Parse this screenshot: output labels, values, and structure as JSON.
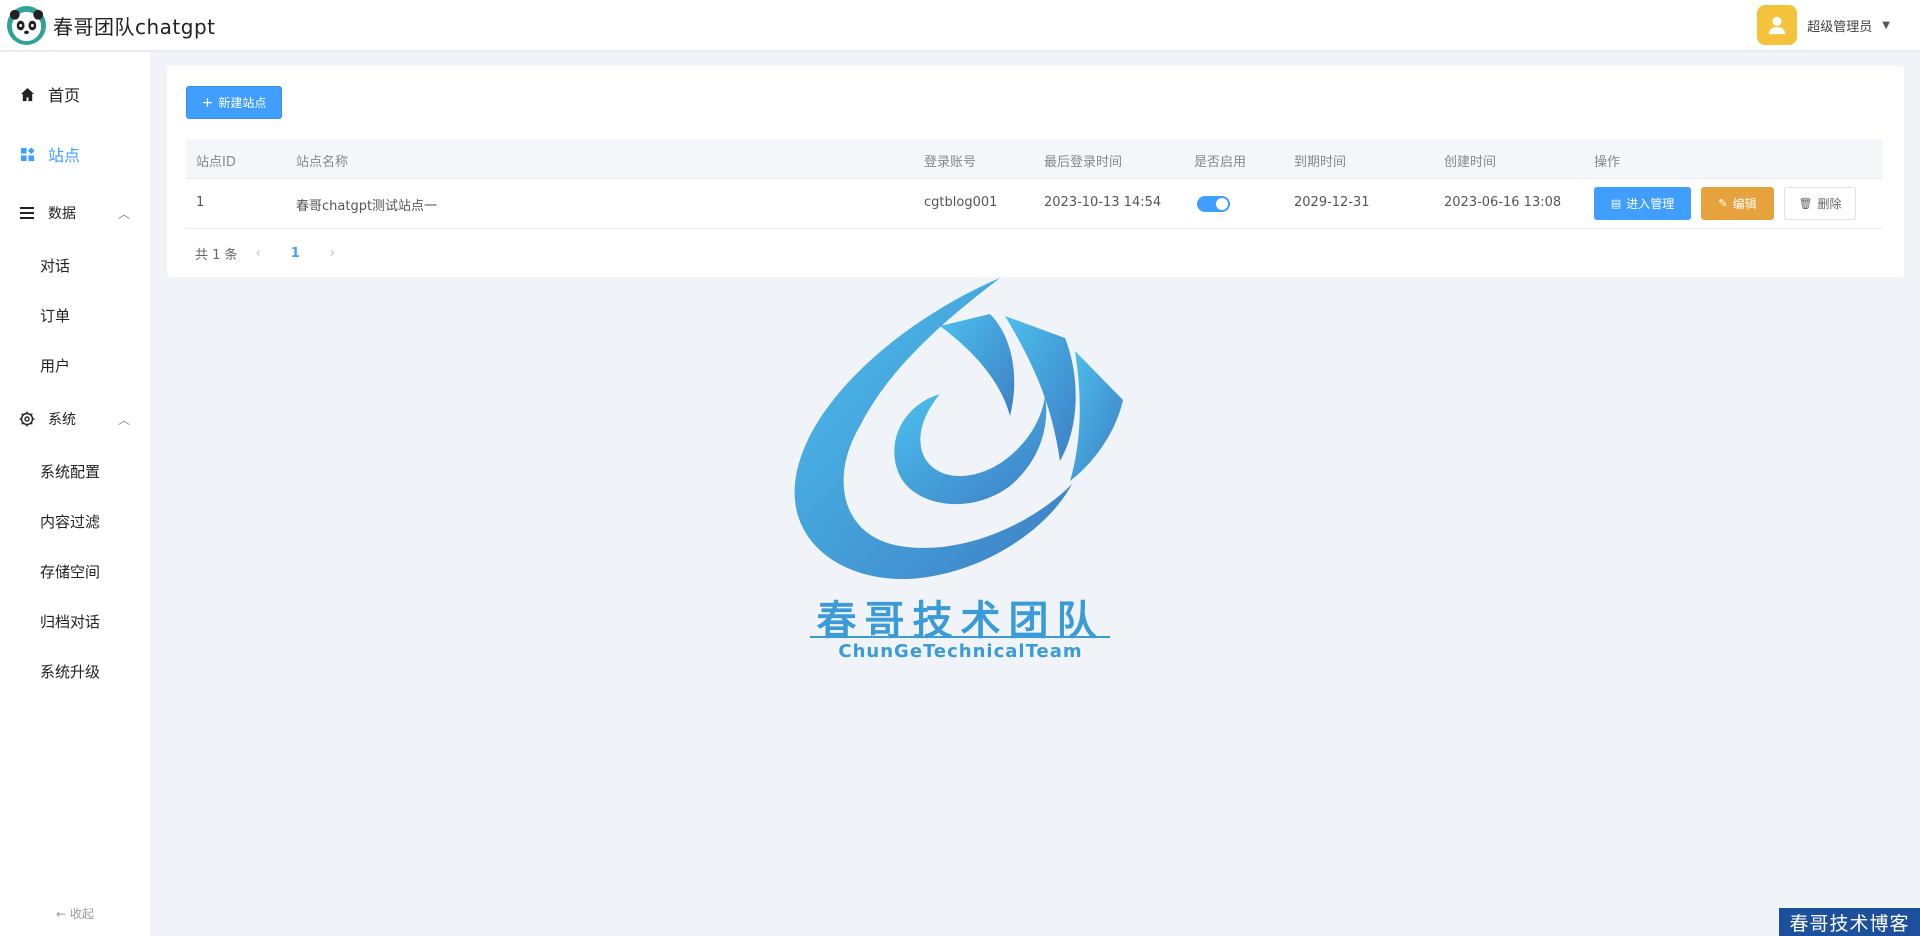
{
  "header": {
    "app_title": "春哥团队chatgpt",
    "user_name": "超级管理员"
  },
  "sidebar": {
    "items": [
      {
        "label": "首页",
        "icon": "home-icon"
      },
      {
        "label": "站点",
        "icon": "grid-icon",
        "active": true
      }
    ],
    "groups": [
      {
        "label": "数据",
        "icon": "list-icon",
        "children": [
          "对话",
          "订单",
          "用户"
        ]
      },
      {
        "label": "系统",
        "icon": "gear-icon",
        "children": [
          "系统配置",
          "内容过滤",
          "存储空间",
          "归档对话",
          "系统升级"
        ]
      }
    ],
    "collapse_label": "收起"
  },
  "toolbar": {
    "new_button": "新建站点"
  },
  "table": {
    "columns": [
      "站点ID",
      "站点名称",
      "登录账号",
      "最后登录时间",
      "是否启用",
      "到期时间",
      "创建时间",
      "操作"
    ],
    "rows": [
      {
        "id": "1",
        "name": "春哥chatgpt测试站点一",
        "account": "cgtblog001",
        "last_login": "2023-10-13 14:54",
        "enabled": true,
        "expire": "2029-12-31",
        "created": "2023-06-16 13:08"
      }
    ],
    "actions": {
      "manage": "进入管理",
      "edit": "编辑",
      "delete": "删除"
    }
  },
  "pagination": {
    "total_text": "共 1 条",
    "current_page": "1"
  },
  "watermark": {
    "title": "春哥技术团队",
    "subtitle": "ChunGeTechnicalTeam",
    "corner": "春哥技术博客"
  },
  "colors": {
    "primary": "#409eff",
    "warning": "#e6a23c",
    "avatar": "#f5c33b",
    "watermark": "#3a9bd8"
  }
}
